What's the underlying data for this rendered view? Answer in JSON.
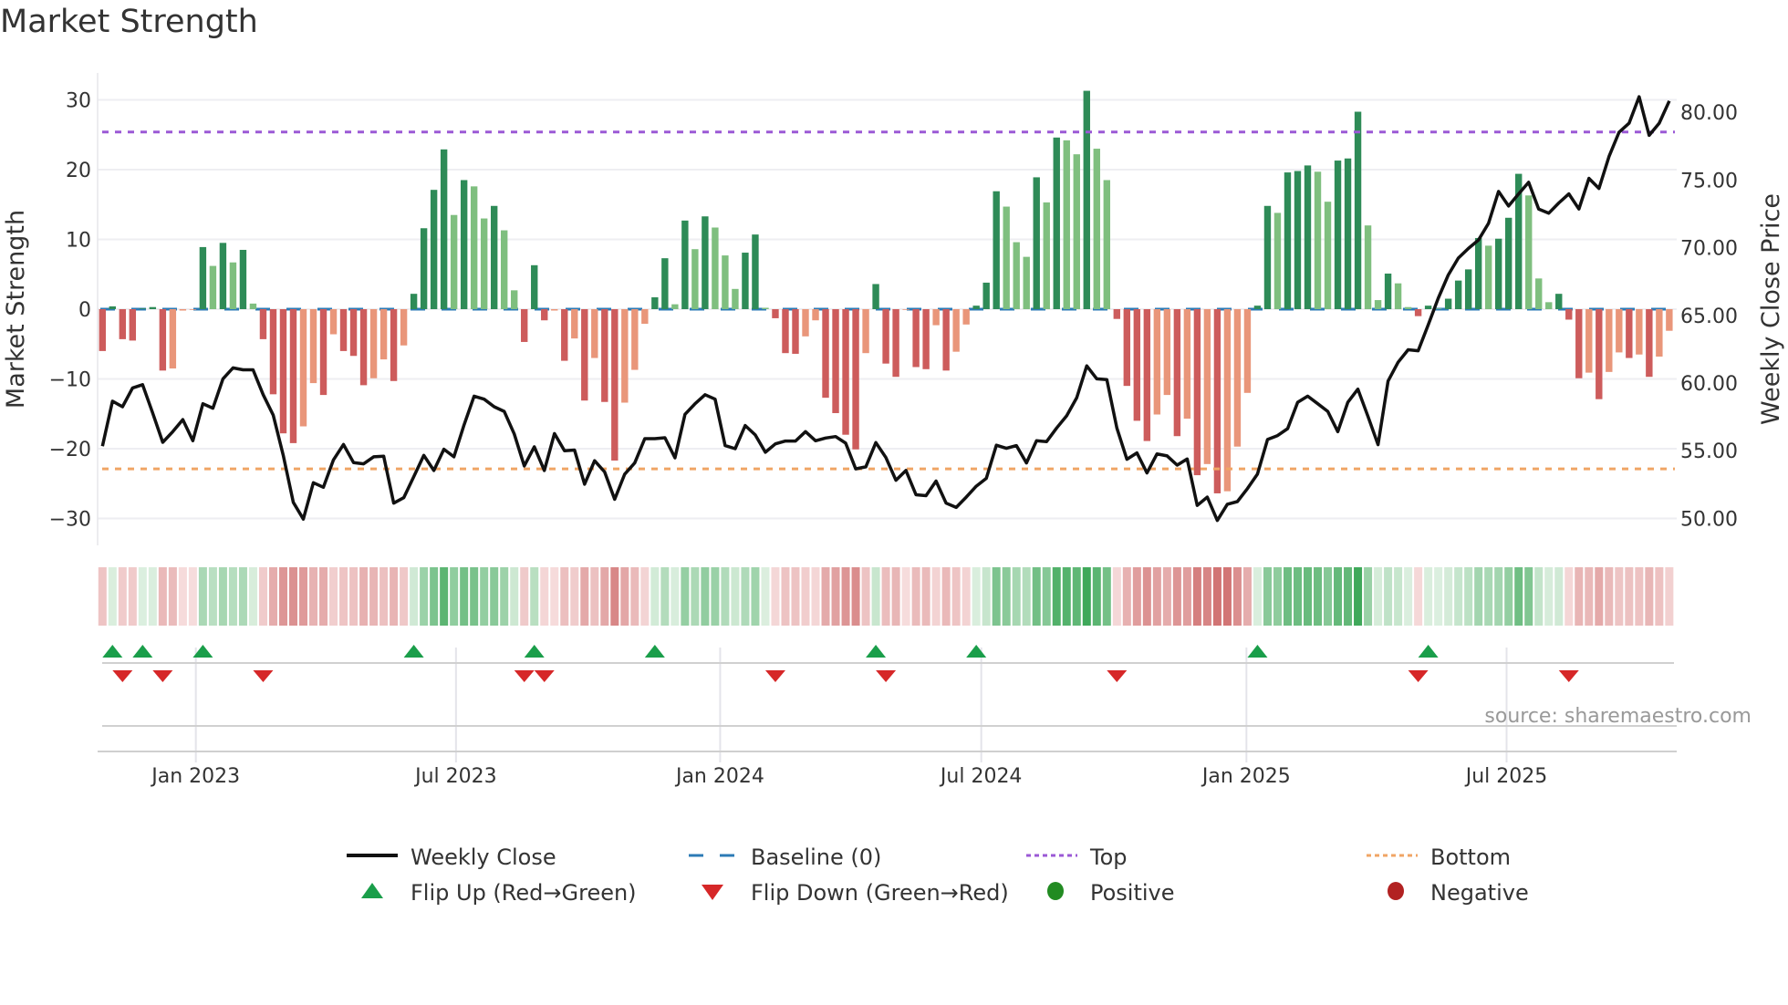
{
  "title": "Market Strength",
  "source": "source: sharemaestro.com",
  "colors": {
    "pos_strong": "#2e8b57",
    "pos_weak": "#7fbf7f",
    "neg_strong": "#cd5c5c",
    "neg_weak": "#e9967a",
    "line": "#111111",
    "baseline": "#2c7bb6",
    "top": "#9b59d6",
    "bottom": "#f0a565",
    "flip_up": "#1a9e4a",
    "flip_down": "#d62728",
    "positive": "#228b22",
    "negative": "#b22222"
  },
  "legend": [
    {
      "key": "weekly_close",
      "label": "Weekly Close"
    },
    {
      "key": "baseline",
      "label": "Baseline (0)"
    },
    {
      "key": "top",
      "label": "Top"
    },
    {
      "key": "bottom",
      "label": "Bottom"
    },
    {
      "key": "flip_up",
      "label": "Flip Up (Red→Green)"
    },
    {
      "key": "flip_down",
      "label": "Flip Down (Green→Red)"
    },
    {
      "key": "positive",
      "label": "Positive"
    },
    {
      "key": "negative",
      "label": "Negative"
    }
  ],
  "chart_data": {
    "type": "bar+line",
    "title": "Market Strength",
    "ylabel": "Market Strength",
    "y2label": "Weekly Close Price",
    "ylim": [
      -33,
      33
    ],
    "yticks": [
      30,
      20,
      10,
      0,
      -10,
      -20,
      -30
    ],
    "y2ticks": [
      "80.00",
      "75.00",
      "70.00",
      "65.00",
      "60.00",
      "55.00",
      "50.00"
    ],
    "y2lim": [
      48.45,
      82.47
    ],
    "top_level": 25.4,
    "bottom_level": -22.9,
    "x_ticks": [
      {
        "label": "Jan 2023",
        "week": 9.3
      },
      {
        "label": "Jul 2023",
        "week": 35.2
      },
      {
        "label": "Jan 2024",
        "week": 61.5
      },
      {
        "label": "Jul 2024",
        "week": 87.5
      },
      {
        "label": "Jan 2025",
        "week": 113.9
      },
      {
        "label": "Jul 2025",
        "week": 139.8
      }
    ],
    "strength": [
      -6.0,
      0.4,
      -4.3,
      -4.5,
      0.1,
      0.3,
      -8.8,
      -8.5,
      -0.2,
      -0.1,
      8.9,
      6.2,
      9.5,
      6.7,
      8.5,
      0.8,
      -4.3,
      -12.2,
      -17.8,
      -19.2,
      -16.8,
      -10.6,
      -12.3,
      -3.6,
      -6.0,
      -6.7,
      -10.9,
      -9.9,
      -7.2,
      -10.3,
      -5.2,
      2.2,
      11.6,
      17.1,
      22.9,
      13.5,
      18.5,
      17.6,
      13.0,
      14.8,
      11.3,
      2.7,
      -4.7,
      6.3,
      -1.6,
      -0.2,
      -7.4,
      -4.2,
      -13.1,
      -7.0,
      -13.3,
      -21.7,
      -13.4,
      -8.7,
      -2.1,
      1.7,
      7.3,
      0.7,
      12.7,
      8.6,
      13.3,
      11.7,
      7.7,
      2.9,
      8.1,
      10.7,
      0.2,
      -1.3,
      -6.3,
      -6.4,
      -3.9,
      -1.6,
      -12.7,
      -14.9,
      -18.0,
      -20.1,
      -6.3,
      3.6,
      -7.8,
      -9.7,
      -0.1,
      -8.3,
      -8.6,
      -2.3,
      -8.8,
      -6.1,
      -2.2,
      0.5,
      3.8,
      16.9,
      14.7,
      9.6,
      7.5,
      18.9,
      15.3,
      24.6,
      24.2,
      22.2,
      31.3,
      23.0,
      18.5,
      -1.4,
      -11.0,
      -16.0,
      -18.9,
      -15.1,
      -12.3,
      -18.2,
      -15.7,
      -23.8,
      -22.2,
      -26.4,
      -26.1,
      -19.7,
      -12.0,
      0.5,
      14.8,
      13.8,
      19.6,
      19.8,
      20.6,
      19.7,
      15.4,
      21.3,
      21.6,
      28.3,
      12.0,
      1.3,
      5.1,
      3.7,
      0.3,
      -1.0,
      0.5,
      0.1,
      1.5,
      4.1,
      5.7,
      10.2,
      9.1,
      10.1,
      13.1,
      19.4,
      16.3,
      4.4,
      1.0,
      2.2,
      -1.5,
      -9.9,
      -9.1,
      -12.9,
      -9.0,
      -6.2,
      -7.0,
      -6.5,
      -9.7,
      -6.8,
      -3.1
    ],
    "weekly_close": [
      55.33,
      58.66,
      58.25,
      59.64,
      59.88,
      57.8,
      55.62,
      56.41,
      57.3,
      55.74,
      58.47,
      58.14,
      60.31,
      61.12,
      60.98,
      60.98,
      59.14,
      57.63,
      54.66,
      51.19,
      49.95,
      52.64,
      52.3,
      54.32,
      55.46,
      54.12,
      54.03,
      54.55,
      54.59,
      51.13,
      51.53,
      53.09,
      54.66,
      53.54,
      55.11,
      54.55,
      56.91,
      59.03,
      58.81,
      58.25,
      57.91,
      56.24,
      53.88,
      55.29,
      53.54,
      56.27,
      55.0,
      55.05,
      52.53,
      54.26,
      53.43,
      51.41,
      53.27,
      54.1,
      55.89,
      55.89,
      55.96,
      54.48,
      57.69,
      58.47,
      59.14,
      58.81,
      55.38,
      55.15,
      56.86,
      56.17,
      54.89,
      55.51,
      55.72,
      55.72,
      56.41,
      55.74,
      55.94,
      56.05,
      55.56,
      53.66,
      53.81,
      55.6,
      54.5,
      52.82,
      53.54,
      51.75,
      51.68,
      52.76,
      51.13,
      50.81,
      51.57,
      52.38,
      52.96,
      55.41,
      55.18,
      55.38,
      54.1,
      55.74,
      55.67,
      56.68,
      57.58,
      58.92,
      61.27,
      60.31,
      60.26,
      56.68,
      54.37,
      54.84,
      53.36,
      54.77,
      54.62,
      53.94,
      54.39,
      50.96,
      51.57,
      49.85,
      51.05,
      51.24,
      52.2,
      53.27,
      55.83,
      56.12,
      56.63,
      58.58,
      59.03,
      58.47,
      57.91,
      56.41,
      58.58,
      59.55,
      57.53,
      55.45,
      60.15,
      61.54,
      62.46,
      62.39,
      64.3,
      66.27,
      67.99,
      69.23,
      69.95,
      70.57,
      71.8,
      74.16,
      73.08,
      73.98,
      74.83,
      72.86,
      72.55,
      73.31,
      73.98,
      72.86,
      75.12,
      74.38,
      76.74,
      78.53,
      79.2,
      81.15,
      78.3,
      79.2,
      80.84
    ],
    "flip_up_weeks": [
      1,
      4,
      10,
      31,
      43,
      55,
      77,
      87,
      115,
      132
    ],
    "flip_down_weeks": [
      2,
      6,
      16,
      42,
      44,
      67,
      78,
      101,
      131,
      146
    ]
  }
}
